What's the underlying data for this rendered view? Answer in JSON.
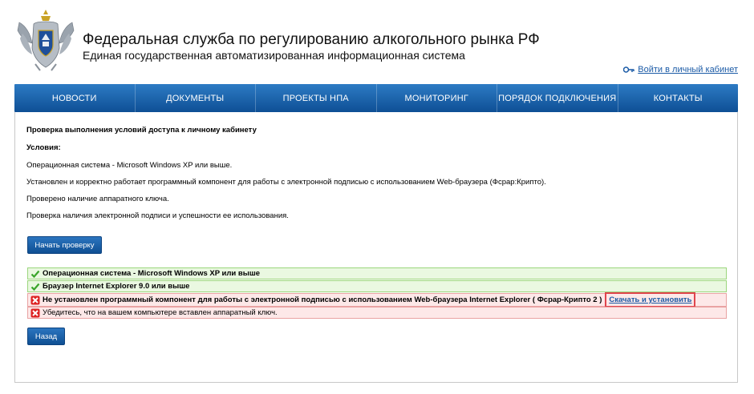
{
  "header": {
    "title": "Федеральная служба по регулированию алкогольного рынка РФ",
    "subtitle": "Единая государственная автоматизированная информационная система",
    "login_link": "Войти в личный кабинет"
  },
  "nav": {
    "items": [
      "НОВОСТИ",
      "ДОКУМЕНТЫ",
      "ПРОЕКТЫ НПА",
      "МОНИТОРИНГ",
      "ПОРЯДОК ПОДКЛЮЧЕНИЯ",
      "КОНТАКТЫ"
    ]
  },
  "main": {
    "heading": "Проверка выполнения условий доступа к личному кабинету",
    "conditions_label": "Условия:",
    "conditions": [
      "Операционная система - Microsoft Windows XP или выше.",
      "Установлен и корректно работает программный компонент для работы с электронной подписью с использованием Web-браузера (Фсрар:Крипто).",
      "Проверено наличие аппаратного ключа.",
      "Проверка наличия электронной подписи и успешности ее использования."
    ],
    "start_button": "Начать проверку",
    "results": [
      {
        "status": "ok",
        "text": "Операционная система - Microsoft Windows XP или выше"
      },
      {
        "status": "ok",
        "text": "Браузер Internet Explorer 9.0 или выше"
      },
      {
        "status": "error",
        "text": "Не установлен программный компонент для работы с электронной подписью с использованием Web-браузера Internet Explorer ( Фсрар-Крипто 2 )",
        "link": "Скачать и установить"
      },
      {
        "status": "error",
        "text": "Убедитесь, что на вашем компьютере вставлен аппаратный ключ."
      }
    ],
    "back_button": "Назад"
  },
  "colors": {
    "nav_bg": "#1a63ad",
    "ok_bg": "#eaf8e1",
    "error_bg": "#fde8e8",
    "highlight_border": "#e0454d",
    "link": "#1a5aa6"
  }
}
